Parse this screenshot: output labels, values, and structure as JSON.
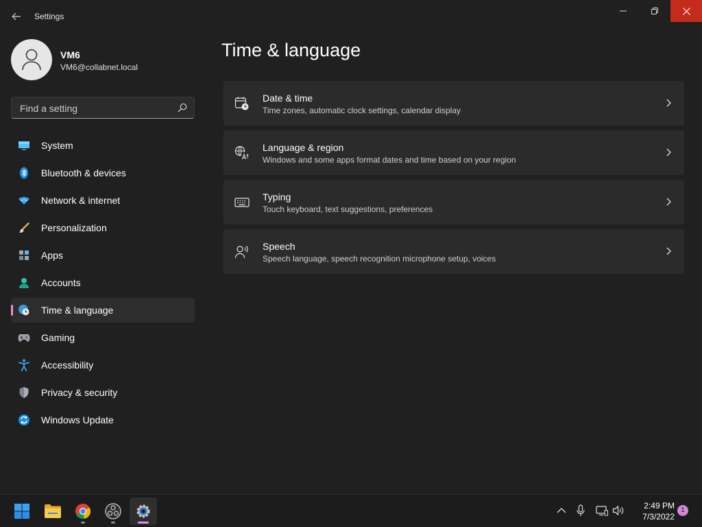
{
  "window": {
    "title": "Settings",
    "back_icon": "arrow-left-icon",
    "minimize_icon": "minimize-icon",
    "maximize_icon": "restore-icon",
    "close_icon": "close-icon",
    "close_color": "#c42b1c"
  },
  "profile": {
    "name": "VM6",
    "email": "VM6@collabnet.local",
    "avatar_icon": "person-icon"
  },
  "search": {
    "placeholder": "Find a setting",
    "value": "",
    "icon": "search-icon"
  },
  "sidebar": {
    "selected": "Time & language",
    "accent": "#e88ee5",
    "items": [
      {
        "label": "System",
        "icon": "monitor-icon"
      },
      {
        "label": "Bluetooth & devices",
        "icon": "bluetooth-icon"
      },
      {
        "label": "Network & internet",
        "icon": "wifi-icon"
      },
      {
        "label": "Personalization",
        "icon": "brush-icon"
      },
      {
        "label": "Apps",
        "icon": "apps-icon"
      },
      {
        "label": "Accounts",
        "icon": "account-icon"
      },
      {
        "label": "Time & language",
        "icon": "globe-clock-icon"
      },
      {
        "label": "Gaming",
        "icon": "gamepad-icon"
      },
      {
        "label": "Accessibility",
        "icon": "accessibility-icon"
      },
      {
        "label": "Privacy & security",
        "icon": "shield-icon"
      },
      {
        "label": "Windows Update",
        "icon": "update-icon"
      }
    ]
  },
  "main": {
    "title": "Time & language",
    "cards": [
      {
        "title": "Date & time",
        "description": "Time zones, automatic clock settings, calendar display",
        "icon": "calendar-clock-icon"
      },
      {
        "title": "Language & region",
        "description": "Windows and some apps format dates and time based on your region",
        "icon": "language-icon"
      },
      {
        "title": "Typing",
        "description": "Touch keyboard, text suggestions, preferences",
        "icon": "keyboard-icon"
      },
      {
        "title": "Speech",
        "description": "Speech language, speech recognition microphone setup, voices",
        "icon": "speech-icon"
      }
    ]
  },
  "taskbar": {
    "apps": [
      {
        "name": "Start",
        "icon": "windows-start-icon"
      },
      {
        "name": "File Explorer",
        "icon": "folder-icon"
      },
      {
        "name": "Google Chrome",
        "icon": "chrome-icon"
      },
      {
        "name": "OBS Studio",
        "icon": "obs-icon"
      },
      {
        "name": "Settings",
        "icon": "gear-icon",
        "active": true
      }
    ],
    "tray": {
      "icons": [
        "chevron-up-icon",
        "microphone-icon",
        "network-icon",
        "volume-icon"
      ],
      "time": "2:49 PM",
      "date": "7/3/2022",
      "notification_count": "1"
    }
  }
}
